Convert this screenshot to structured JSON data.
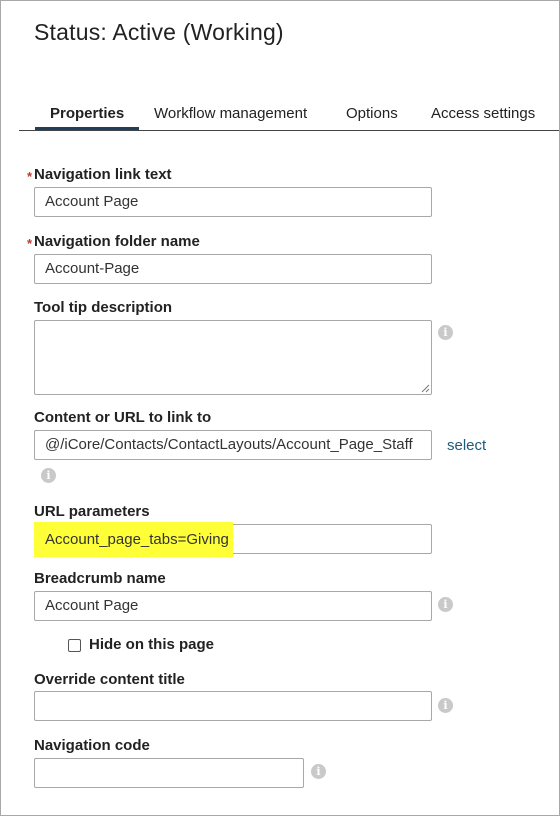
{
  "page": {
    "title": "Status: Active (Working)"
  },
  "tabs": [
    {
      "label": "Properties",
      "active": true
    },
    {
      "label": "Workflow management",
      "active": false
    },
    {
      "label": "Options",
      "active": false
    },
    {
      "label": "Access settings",
      "active": false
    }
  ],
  "form": {
    "required_marker": "*",
    "nav_link_text": {
      "label": "Navigation link text",
      "value": "Account Page",
      "required": true
    },
    "nav_folder_name": {
      "label": "Navigation folder name",
      "value": "Account-Page",
      "required": true
    },
    "tooltip_description": {
      "label": "Tool tip description",
      "value": ""
    },
    "content_url": {
      "label": "Content or URL to link to",
      "value": "@/iCore/Contacts/ContactLayouts/Account_Page_Staff",
      "select_label": "select"
    },
    "url_parameters": {
      "label": "URL parameters",
      "value": "Account_page_tabs=Giving",
      "highlight_color": "#ffff38"
    },
    "breadcrumb_name": {
      "label": "Breadcrumb name",
      "value": "Account Page"
    },
    "hide_on_page": {
      "label": "Hide on this page",
      "checked": false
    },
    "override_content_title": {
      "label": "Override content title",
      "value": ""
    },
    "navigation_code": {
      "label": "Navigation code",
      "value": ""
    }
  },
  "icons": {
    "info": "info-icon",
    "info_glyph": "i"
  },
  "colors": {
    "tab_underline": "#1f3f5c",
    "link": "#1f5a7a",
    "required": "#c0392b",
    "info_icon": "#c9c9c9"
  }
}
